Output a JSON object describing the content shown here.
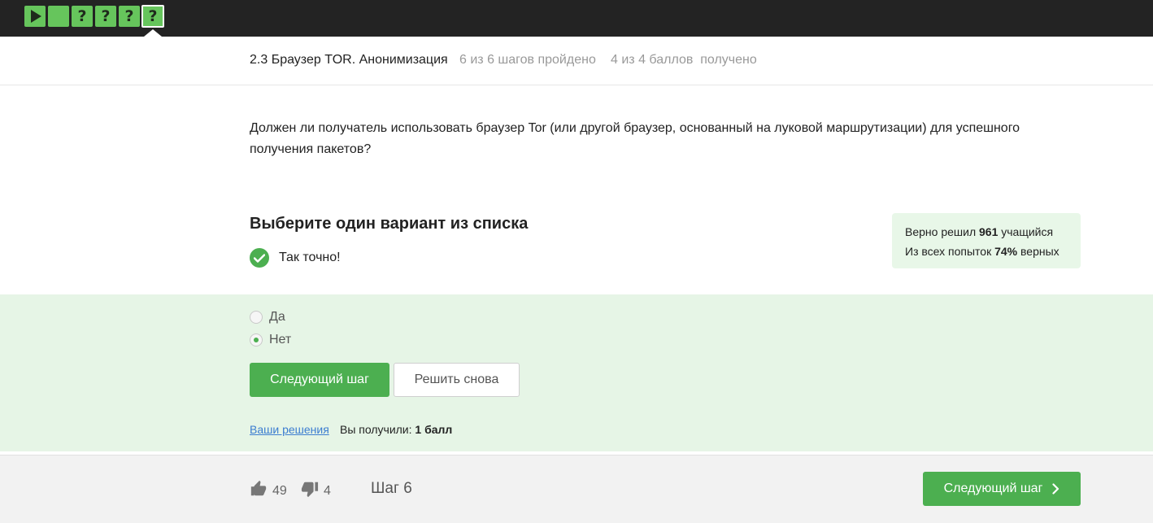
{
  "steps_bar": {
    "steps": [
      {
        "type": "video",
        "icon": "play-icon",
        "status": "passed"
      },
      {
        "type": "text",
        "icon": "text-step-icon",
        "status": "passed"
      },
      {
        "type": "quiz",
        "icon": "question-icon",
        "glyph": "?",
        "status": "passed"
      },
      {
        "type": "quiz",
        "icon": "question-icon",
        "glyph": "?",
        "status": "passed"
      },
      {
        "type": "quiz",
        "icon": "question-icon",
        "glyph": "?",
        "status": "passed"
      },
      {
        "type": "quiz",
        "icon": "question-icon",
        "glyph": "?",
        "status": "passed",
        "current": true
      }
    ]
  },
  "lesson": {
    "title": "2.3 Браузер TOR. Анонимизация",
    "progress_text": "6 из 6 шагов пройдено",
    "score_text": "4 из 4 баллов  получено"
  },
  "question": {
    "text": "Должен ли получатель использовать браузер Tor (или другой браузер, основанный на луковой маршрутизации) для успешного получения пакетов?"
  },
  "task": {
    "title": "Выберите один вариант из списка",
    "feedback": "Так точно!"
  },
  "stats": {
    "solved_prefix": "Верно решил",
    "solved_count": "961",
    "solved_suffix": "учащийся",
    "attempts_prefix": "Из всех попыток",
    "attempts_percent": "74%",
    "attempts_suffix": "верных"
  },
  "options": [
    {
      "label": "Да",
      "selected": false
    },
    {
      "label": "Нет",
      "selected": true
    }
  ],
  "actions": {
    "next_step": "Следующий шаг",
    "solve_again": "Решить снова"
  },
  "result": {
    "solutions_link": "Ваши решения",
    "got_label": "Вы получили:",
    "got_value": "1 балл"
  },
  "footer": {
    "likes": "49",
    "dislikes": "4",
    "step_label": "Шаг 6",
    "next_button": "Следующий шаг"
  },
  "colors": {
    "accent": "#4caf50",
    "step_green": "#66c55c",
    "answer_bg": "#e6f5e6",
    "stats_bg": "#e8f7e8",
    "topbar": "#232323"
  }
}
